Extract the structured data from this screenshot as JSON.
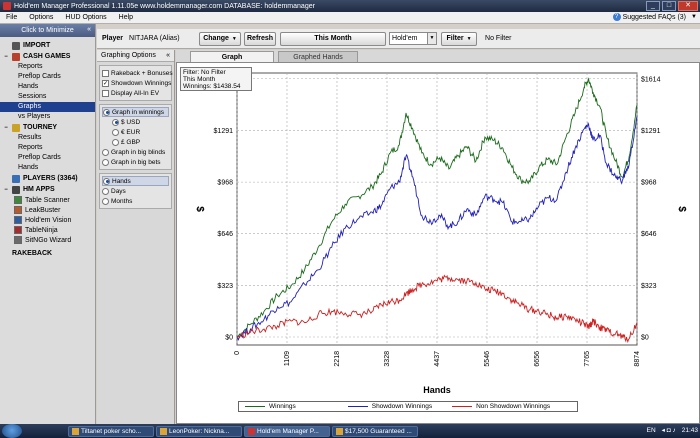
{
  "window": {
    "title": "Hold'em Manager Professional 1.11.05e     www.holdemmanager.com     DATABASE: holdemmanager"
  },
  "menu": {
    "items": [
      "File",
      "Options",
      "HUD Options",
      "Help"
    ],
    "faq_label": "Suggested FAQs (3)"
  },
  "sidebar": {
    "minimize_label": "Click to Minimize",
    "import_label": "IMPORT",
    "cash_games_label": "CASH GAMES",
    "cash_items": [
      "Reports",
      "Preflop Cards",
      "Hands",
      "Sessions",
      "Graphs",
      "vs Players"
    ],
    "tourney_label": "TOURNEY",
    "tourney_items": [
      "Results",
      "Reports",
      "Preflop Cards",
      "Hands"
    ],
    "players_label": "PLAYERS (3364)",
    "hm_apps_label": "HM APPS",
    "apps": [
      "Table Scanner",
      "LeakBuster",
      "Hold'em Vision",
      "TableNinja",
      "SitNGo Wizard"
    ],
    "rakeback_label": "RAKEBACK"
  },
  "playerbar": {
    "player_label": "Player",
    "player_name": "NITJARA (Alias)",
    "change_label": "Change",
    "refresh_label": "Refresh",
    "date_label": "This Month",
    "game_value": "Hold'em",
    "filter_label": "Filter",
    "filter_status": "No Filter"
  },
  "options": {
    "title": "Graphing Options",
    "checkboxes": [
      {
        "label": "Rakeback + Bonuses",
        "checked": false
      },
      {
        "label": "Showdown Winnings",
        "checked": true
      },
      {
        "label": "Display All-In EV",
        "checked": false
      }
    ],
    "graph_in_winnings": "Graph in winnings",
    "currencies": [
      "$ USD",
      "€ EUR",
      "£ GBP"
    ],
    "graph_in_big_blinds": "Graph in big blinds",
    "graph_in_big_bets": "Graph in big bets",
    "x_axis": [
      "Hands",
      "Days",
      "Months"
    ]
  },
  "tabs": [
    "Graph",
    "Graphed Hands"
  ],
  "filter_box": {
    "line1": "Filter: No Filter",
    "line2": "This Month",
    "line3": "Winnings: $1438.54"
  },
  "colors": {
    "winnings": "#1a6b1a",
    "showdown": "#2222bb",
    "non_showdown": "#cc2222"
  },
  "chart_data": {
    "type": "line",
    "xlabel": "Hands",
    "ylabel": "$",
    "x_ticks": [
      "0",
      "1109",
      "2218",
      "3328",
      "4437",
      "5546",
      "6656",
      "7765",
      "8874"
    ],
    "y_ticks": [
      "$0",
      "$323",
      "$646",
      "$968",
      "$1291",
      "$1614"
    ],
    "xlim": [
      0,
      8874
    ],
    "ylim": [
      -50,
      1650
    ],
    "grid": true,
    "series": [
      {
        "name": "Winnings",
        "color": "#1a6b1a",
        "x": [
          0,
          300,
          600,
          900,
          1200,
          1500,
          1800,
          2100,
          2400,
          2700,
          3000,
          3200,
          3400,
          3600,
          3750,
          3900,
          4100,
          4300,
          4500,
          4700,
          4900,
          5100,
          5300,
          5500,
          5700,
          5900,
          6100,
          6300,
          6500,
          6700,
          6900,
          7100,
          7300,
          7500,
          7700,
          7800,
          7900,
          8050,
          8200,
          8400,
          8550,
          8700,
          8874
        ],
        "y": [
          0,
          80,
          160,
          260,
          320,
          420,
          560,
          720,
          830,
          880,
          940,
          1020,
          1150,
          1200,
          1400,
          1300,
          1150,
          1080,
          1120,
          1050,
          1130,
          1190,
          1100,
          1250,
          1230,
          1180,
          1060,
          980,
          970,
          1060,
          1110,
          1080,
          1250,
          1400,
          1560,
          1614,
          1530,
          1440,
          1250,
          1100,
          1000,
          1130,
          1450
        ]
      },
      {
        "name": "Showdown Winnings",
        "color": "#2222bb",
        "x": [
          0,
          300,
          600,
          900,
          1200,
          1500,
          1800,
          2100,
          2400,
          2700,
          3000,
          3200,
          3400,
          3600,
          3750,
          3900,
          4100,
          4300,
          4500,
          4700,
          4900,
          5100,
          5300,
          5500,
          5700,
          5900,
          6100,
          6300,
          6500,
          6700,
          6900,
          7100,
          7300,
          7500,
          7700,
          7800,
          7900,
          8050,
          8200,
          8400,
          8550,
          8700,
          8874
        ],
        "y": [
          0,
          50,
          110,
          190,
          220,
          330,
          420,
          560,
          680,
          740,
          780,
          820,
          930,
          970,
          1130,
          1000,
          760,
          720,
          760,
          690,
          720,
          800,
          760,
          880,
          860,
          840,
          720,
          720,
          740,
          820,
          870,
          860,
          1030,
          1180,
          1300,
          1330,
          1230,
          1260,
          1080,
          1000,
          980,
          1080,
          1380
        ]
      },
      {
        "name": "Non Showdown Winnings",
        "color": "#cc2222",
        "x": [
          0,
          300,
          600,
          900,
          1200,
          1500,
          1800,
          2100,
          2400,
          2700,
          3000,
          3200,
          3400,
          3600,
          3750,
          3900,
          4100,
          4300,
          4500,
          4700,
          4900,
          5100,
          5300,
          5500,
          5700,
          5900,
          6100,
          6300,
          6500,
          6700,
          6900,
          7100,
          7300,
          7500,
          7700,
          7800,
          7900,
          8050,
          8200,
          8400,
          8550,
          8700,
          8874
        ],
        "y": [
          0,
          30,
          50,
          70,
          100,
          90,
          140,
          160,
          150,
          140,
          160,
          200,
          220,
          230,
          270,
          300,
          330,
          340,
          360,
          370,
          360,
          350,
          340,
          300,
          290,
          270,
          230,
          200,
          170,
          160,
          140,
          120,
          130,
          110,
          80,
          60,
          100,
          60,
          40,
          20,
          0,
          -10,
          90
        ]
      }
    ]
  },
  "taskbar": {
    "tasks": [
      "Tiltanet poker scho...",
      "LeonPoker: Nickna...",
      "Hold'em Manager P...",
      "$17,500 Guaranteed ..."
    ],
    "active_index": 2,
    "lang": "EN",
    "clock": "21:43"
  }
}
